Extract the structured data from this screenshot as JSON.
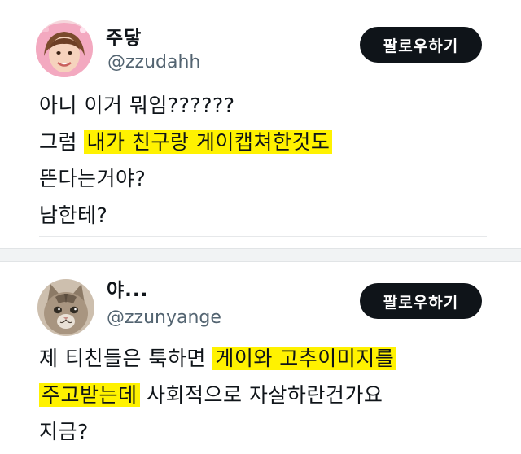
{
  "tweets": [
    {
      "display_name": "주닿",
      "handle": "@zzudahh",
      "follow_label": "팔로우하기",
      "lines": [
        {
          "plain": "아니 이거 뭐임??????",
          "highlight": "",
          "after": ""
        },
        {
          "plain": "그럼 ",
          "highlight": "내가 친구랑 게이캡쳐한것도",
          "after": ""
        },
        {
          "plain": "뜬다는거야?",
          "highlight": "",
          "after": ""
        },
        {
          "plain": "남한테?",
          "highlight": "",
          "after": ""
        }
      ]
    },
    {
      "display_name": "야...",
      "handle": "@zzunyange",
      "follow_label": "팔로우하기",
      "lines": [
        {
          "plain": "제 티친들은 툭하면 ",
          "highlight": "게이와 고추이미지를",
          "after": ""
        },
        {
          "plain": "",
          "highlight": "주고받는데",
          "after": " 사회적으로 자살하란건가요"
        },
        {
          "plain": "지금?",
          "highlight": "",
          "after": ""
        }
      ]
    }
  ],
  "colors": {
    "highlight": "#fff200",
    "follow_button_bg": "#0f1419",
    "handle_text": "#536471"
  },
  "icons": {
    "avatar_1": "avatar-woman-pink-hood",
    "avatar_2": "avatar-tabby-cat"
  }
}
